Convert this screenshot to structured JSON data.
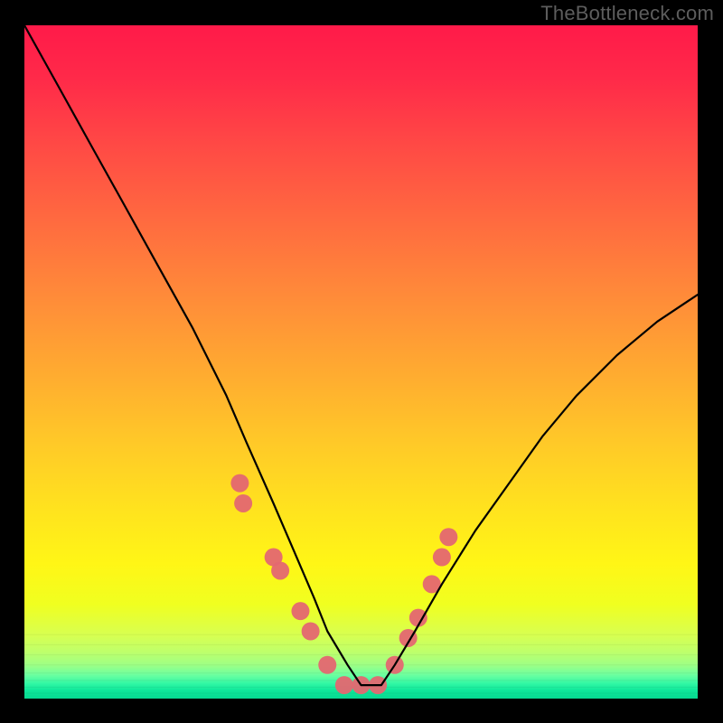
{
  "watermark": "TheBottleneck.com",
  "chart_data": {
    "type": "line",
    "title": "",
    "xlabel": "",
    "ylabel": "",
    "xlim": [
      0,
      100
    ],
    "ylim": [
      0,
      100
    ],
    "grid": false,
    "legend": false,
    "series": [
      {
        "name": "curve",
        "color": "#000000",
        "x": [
          0,
          5,
          10,
          15,
          20,
          25,
          30,
          33,
          37,
          40,
          43,
          45,
          48,
          50,
          53,
          55,
          58,
          62,
          67,
          72,
          77,
          82,
          88,
          94,
          100
        ],
        "y": [
          100,
          91,
          82,
          73,
          64,
          55,
          45,
          38,
          29,
          22,
          15,
          10,
          5,
          2,
          2,
          5,
          10,
          17,
          25,
          32,
          39,
          45,
          51,
          56,
          60
        ]
      }
    ],
    "scatter_points": {
      "color": "#e46771",
      "radius": 10,
      "x": [
        32,
        32.5,
        37,
        38,
        41,
        42.5,
        45,
        47.5,
        50,
        52.5,
        55,
        57,
        58.5,
        60.5,
        62,
        63
      ],
      "y": [
        32,
        29,
        21,
        19,
        13,
        10,
        5,
        2,
        2,
        2,
        5,
        9,
        12,
        17,
        21,
        24
      ]
    },
    "background_gradient": {
      "stops": [
        {
          "offset": 0.0,
          "color": "#ff1a49"
        },
        {
          "offset": 0.08,
          "color": "#ff2a49"
        },
        {
          "offset": 0.18,
          "color": "#ff4a45"
        },
        {
          "offset": 0.3,
          "color": "#ff6d3f"
        },
        {
          "offset": 0.42,
          "color": "#ff9038"
        },
        {
          "offset": 0.52,
          "color": "#ffac30"
        },
        {
          "offset": 0.62,
          "color": "#ffc928"
        },
        {
          "offset": 0.72,
          "color": "#ffe31e"
        },
        {
          "offset": 0.8,
          "color": "#fff616"
        },
        {
          "offset": 0.86,
          "color": "#f0ff20"
        },
        {
          "offset": 0.905,
          "color": "#d8ff50"
        },
        {
          "offset": 0.93,
          "color": "#bfff6a"
        },
        {
          "offset": 0.95,
          "color": "#9eff85"
        },
        {
          "offset": 0.965,
          "color": "#6cffa0"
        },
        {
          "offset": 0.978,
          "color": "#30f7a4"
        },
        {
          "offset": 0.988,
          "color": "#0ee79a"
        },
        {
          "offset": 1.0,
          "color": "#06d890"
        }
      ]
    }
  }
}
